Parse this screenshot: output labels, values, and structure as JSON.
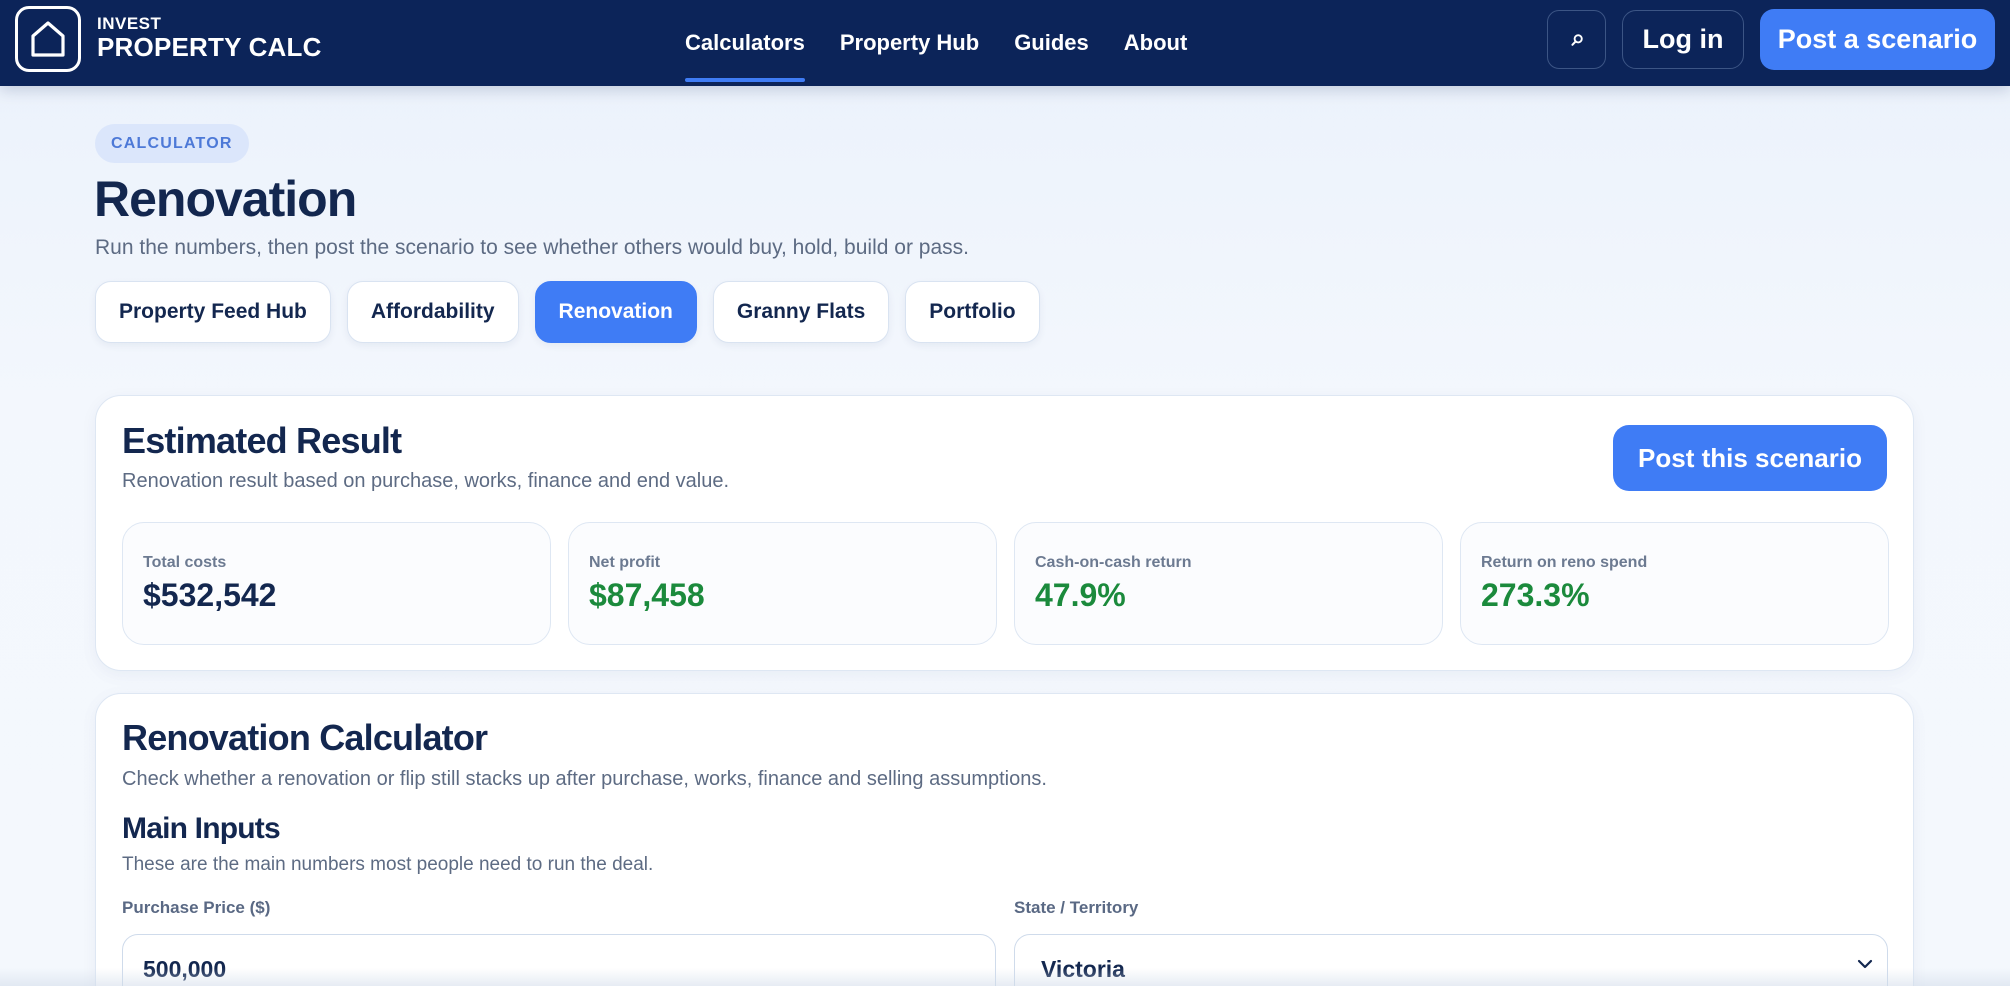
{
  "brand": {
    "line1": "INVEST",
    "line2": "PROPERTY CALC"
  },
  "nav": {
    "links": [
      {
        "label": "Calculators",
        "active": true
      },
      {
        "label": "Property Hub",
        "active": false
      },
      {
        "label": "Guides",
        "active": false
      },
      {
        "label": "About",
        "active": false
      }
    ],
    "search_icon": "search-icon",
    "login_label": "Log in",
    "post_label": "Post a scenario"
  },
  "header": {
    "eyebrow": "CALCULATOR",
    "title": "Renovation",
    "subtitle": "Run the numbers, then post the scenario to see whether others would buy, hold, build or pass."
  },
  "tabs": [
    {
      "label": "Property Feed Hub",
      "active": false
    },
    {
      "label": "Affordability",
      "active": false
    },
    {
      "label": "Renovation",
      "active": true
    },
    {
      "label": "Granny Flats",
      "active": false
    },
    {
      "label": "Portfolio",
      "active": false
    }
  ],
  "result": {
    "title": "Estimated Result",
    "subtitle": "Renovation result based on purchase, works, finance and end value.",
    "post_label": "Post this scenario",
    "stats": [
      {
        "label": "Total costs",
        "value": "$532,542"
      },
      {
        "label": "Net profit",
        "value": "$87,458"
      },
      {
        "label": "Cash-on-cash return",
        "value": "47.9%"
      },
      {
        "label": "Return on reno spend",
        "value": "273.3%"
      }
    ]
  },
  "calculator": {
    "title": "Renovation Calculator",
    "subtitle": "Check whether a renovation or flip still stacks up after purchase, works, finance and selling assumptions.",
    "section_title": "Main Inputs",
    "section_subtitle": "These are the main numbers most people need to run the deal.",
    "purchase_price": {
      "label": "Purchase Price ($)",
      "value": "500,000"
    },
    "state": {
      "label": "State / Territory",
      "value": "Victoria"
    }
  },
  "colors": {
    "nav_bg": "#0c2459",
    "accent": "#3f7cf5",
    "positive": "#1b8a3c",
    "heading": "#13274f"
  }
}
